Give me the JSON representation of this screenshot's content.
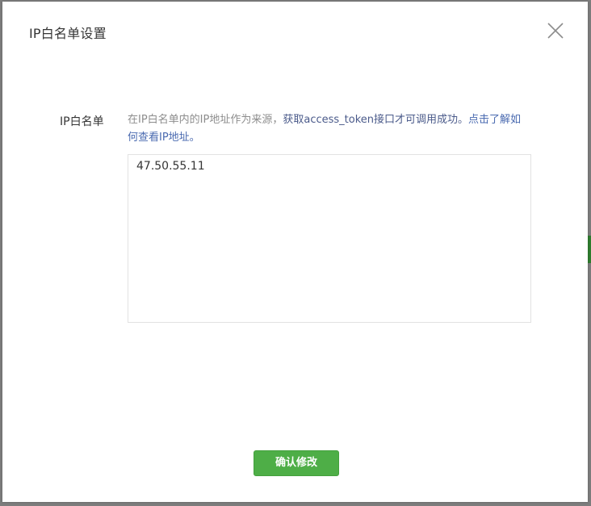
{
  "dialog": {
    "title": "IP白名单设置",
    "close_icon": "close-icon"
  },
  "field": {
    "label": "IP白名单",
    "desc_prefix": "在IP白名单内的IP地址作为来源，",
    "desc_highlight": "获取access_token接口才可调用成功。",
    "desc_link": "点击了解如何查看IP地址。",
    "value": "47.50.55.11"
  },
  "footer": {
    "confirm_label": "确认修改",
    "confirm_color": "#4eae47"
  }
}
